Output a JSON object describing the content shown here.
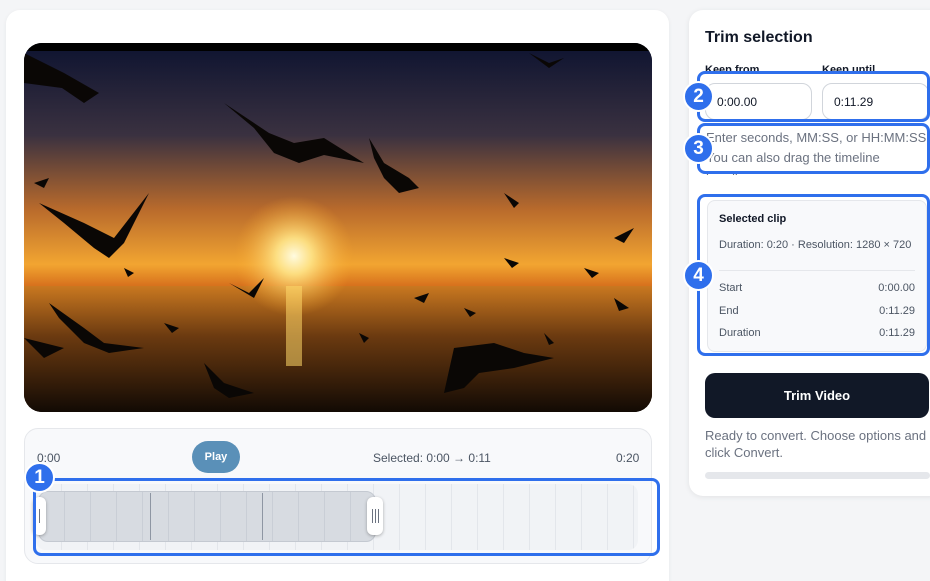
{
  "player": {
    "play_label": "Play",
    "time_start": "0:00",
    "time_end": "0:20",
    "selected_range": "Selected: 0:00 → 0:11"
  },
  "timeline": {
    "selection_start_fraction": 0,
    "selection_end_fraction": 0.5645
  },
  "trim": {
    "title": "Trim selection",
    "keep_from_label": "Keep from",
    "keep_until_label": "Keep until",
    "keep_from_value": "0:00.00",
    "keep_until_value": "0:11.29",
    "hint": "Enter seconds, MM:SS, or HH:MM:SS. You can also drag the timeline handles."
  },
  "clip": {
    "title": "Selected clip",
    "meta": "Duration: 0:20 · Resolution: 1280 × 720",
    "rows": [
      {
        "label": "Start",
        "value": "0:00.00"
      },
      {
        "label": "End",
        "value": "0:11.29"
      },
      {
        "label": "Duration",
        "value": "0:11.29"
      }
    ]
  },
  "actions": {
    "trim_label": "Trim Video",
    "status": "Ready to convert. Choose options and click Convert.",
    "progress_fraction": 0
  },
  "annotations": [
    "1",
    "2",
    "3",
    "4"
  ],
  "colors": {
    "accent": "#2f6fec",
    "play_button": "#5a90b8",
    "primary_button": "#111827"
  }
}
